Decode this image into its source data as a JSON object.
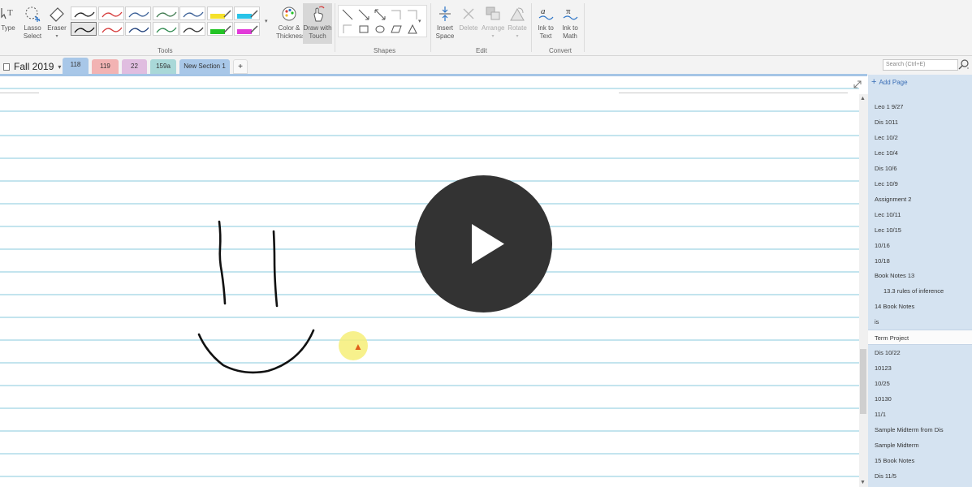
{
  "ribbon": {
    "type_label": "Type",
    "lasso_label": "Lasso Select",
    "eraser_label": "Eraser",
    "color_label": "Color & Thickness",
    "touch_label": "Draw with Touch",
    "insert_space_label": "Insert Space",
    "delete_label": "Delete",
    "arrange_label": "Arrange",
    "rotate_label": "Rotate",
    "ink_text_label": "Ink to Text",
    "ink_math_label": "Ink to Math",
    "groups": {
      "tools": "Tools",
      "shapes": "Shapes",
      "edit": "Edit",
      "convert": "Convert"
    },
    "pens_row1": [
      "#222222",
      "#d63b3b",
      "#3a5f96",
      "#3f7a4f",
      "#3a5f96",
      "#f5e12b",
      "#29c3e8"
    ],
    "pens_row2": [
      "#111111",
      "#d63b3b",
      "#1f3f7a",
      "#2f8a4f",
      "#333333",
      "#23c425",
      "#e23ad9"
    ]
  },
  "sections": {
    "notebook": "Fall 2019",
    "tabs": [
      {
        "label": "118",
        "color": "#a8c7e8"
      },
      {
        "label": "119",
        "color": "#f2b3b3"
      },
      {
        "label": "22",
        "color": "#e0bde0"
      },
      {
        "label": "159a",
        "color": "#a9d8d8"
      },
      {
        "label": "New Section 1",
        "color": "#a8c7e8"
      }
    ],
    "add_tab": "+"
  },
  "search": {
    "placeholder": "Search (Ctrl+E)"
  },
  "pages": {
    "add_label": "Add Page",
    "items": [
      {
        "label": "Leo 1 9/27",
        "sub": false,
        "selected": false
      },
      {
        "label": "Dis 1011",
        "sub": false,
        "selected": false
      },
      {
        "label": "Lec 10/2",
        "sub": false,
        "selected": false
      },
      {
        "label": "Lec 10/4",
        "sub": false,
        "selected": false
      },
      {
        "label": "Dis 10/6",
        "sub": false,
        "selected": false
      },
      {
        "label": "Lec 10/9",
        "sub": false,
        "selected": false
      },
      {
        "label": "Assignment 2",
        "sub": false,
        "selected": false
      },
      {
        "label": "Lec 10/11",
        "sub": false,
        "selected": false
      },
      {
        "label": "Lec 10/15",
        "sub": false,
        "selected": false
      },
      {
        "label": "10/16",
        "sub": false,
        "selected": false
      },
      {
        "label": "10/18",
        "sub": false,
        "selected": false
      },
      {
        "label": "Book Notes 13",
        "sub": false,
        "selected": false
      },
      {
        "label": "13.3 rules of inference",
        "sub": true,
        "selected": false
      },
      {
        "label": "14 Book Notes",
        "sub": false,
        "selected": false
      },
      {
        "label": "is",
        "sub": false,
        "selected": false
      },
      {
        "label": "Term Project",
        "sub": false,
        "selected": true
      },
      {
        "label": "Dis 10/22",
        "sub": false,
        "selected": false
      },
      {
        "label": "10123",
        "sub": false,
        "selected": false
      },
      {
        "label": "10/25",
        "sub": false,
        "selected": false
      },
      {
        "label": "10130",
        "sub": false,
        "selected": false
      },
      {
        "label": "11/1",
        "sub": false,
        "selected": false
      },
      {
        "label": "Sample Midterm from Dis",
        "sub": false,
        "selected": false
      },
      {
        "label": "Sample Midterm",
        "sub": false,
        "selected": false
      },
      {
        "label": "15 Book Notes",
        "sub": false,
        "selected": false
      },
      {
        "label": "Dis 11/5",
        "sub": false,
        "selected": false
      }
    ]
  }
}
